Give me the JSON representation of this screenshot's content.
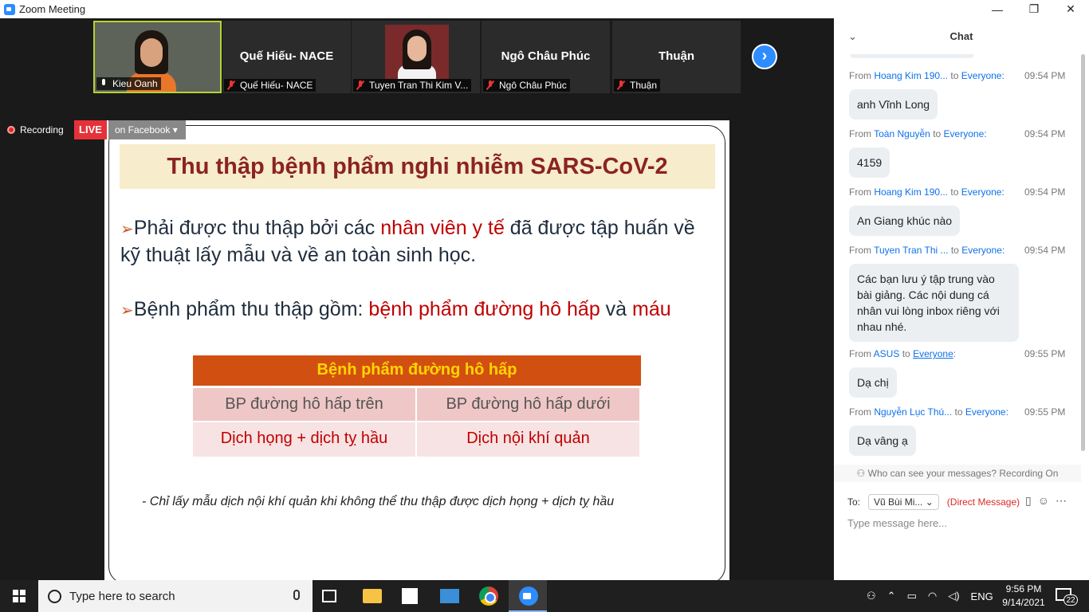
{
  "window": {
    "title": "Zoom Meeting",
    "minimize": "—",
    "restore": "❐",
    "close": "✕"
  },
  "participants": [
    {
      "label": "Kieu Oanh",
      "has_video": true,
      "muted": false
    },
    {
      "name": "Quế Hiếu- NACE",
      "label": "Quế Hiếu- NACE",
      "muted": true
    },
    {
      "label": "Tuyen Tran Thi Kim V...",
      "has_photo": true,
      "muted": true
    },
    {
      "name": "Ngô Châu Phúc",
      "label": "Ngô Châu Phúc",
      "muted": true
    },
    {
      "name": "Thuận",
      "label": "Thuận",
      "muted": true
    }
  ],
  "next_page_icon": "chevron-right-icon",
  "recording": {
    "label": "Recording",
    "live": "LIVE",
    "platform": "on Facebook",
    "caret": "▾"
  },
  "slide": {
    "title": "Thu thập bệnh phẩm nghi nhiễm SARS-CoV-2",
    "bullet1": {
      "arrow": "➢",
      "pre": "Phải được thu thập bởi các ",
      "highlight": "nhân viên y tế",
      "post": " đã được tập huấn về kỹ thuật lấy mẫu và về an toàn sinh học."
    },
    "bullet2": {
      "arrow": "➢",
      "pre": "Bệnh phẩm thu thập gồm: ",
      "highlight1": "bệnh phẩm đường hô hấp",
      "mid": " và ",
      "highlight2": "máu"
    },
    "table": {
      "header": "Bệnh phẩm đường hô hấp",
      "row1": [
        "BP đường hô hấp trên",
        "BP đường hô hấp dưới"
      ],
      "row2": [
        "Dịch họng + dịch tỵ hầu",
        "Dịch nội khí quản"
      ]
    },
    "note": "- Chỉ lấy mẫu dịch nội khí quản khi không thể thu thập được dịch họng + dịch tỵ hầu"
  },
  "chat": {
    "title": "Chat",
    "collapse_icon": "⌄",
    "messages": [
      {
        "from_label": "From",
        "sender": "Hoang Kim 190...",
        "to_label": "to",
        "to": "Everyone:",
        "time": "09:54 PM",
        "text": "anh Vĩnh Long"
      },
      {
        "from_label": "From",
        "sender": "Toàn Nguyễn",
        "to_label": "to",
        "to": "Everyone:",
        "time": "09:54 PM",
        "text": "4159"
      },
      {
        "from_label": "From",
        "sender": "Hoang Kim 190...",
        "to_label": "to",
        "to": "Everyone:",
        "time": "09:54 PM",
        "text": "An Giang khúc nào"
      },
      {
        "from_label": "From",
        "sender": "Tuyen Tran Thi ...",
        "to_label": "to",
        "to": "Everyone:",
        "time": "09:54 PM",
        "text": "Các bạn lưu ý tập trung vào bài giảng. Các nội dung cá nhân vui lòng inbox riêng với nhau nhé."
      },
      {
        "from_label": "From",
        "sender": "ASUS",
        "to_label": "to",
        "to": "Everyone",
        "to_suffix": ":",
        "time": "09:55 PM",
        "text": "Dạ chị"
      },
      {
        "from_label": "From",
        "sender": "Nguyễn Lục Thú...",
        "to_label": "to",
        "to": "Everyone:",
        "time": "09:55 PM",
        "text": "Dạ vâng ạ"
      }
    ],
    "who_can_see": "Who can see your messages? Recording On",
    "to_label": "To:",
    "recipient": "Vũ Bùi Mi...",
    "recipient_caret": "⌄",
    "direct_message": "(Direct Message)",
    "input_placeholder": "Type message here..."
  },
  "taskbar": {
    "search_placeholder": "Type here to search",
    "tray_people": "⚇",
    "tray_chevron": "⌃",
    "tray_battery": "▭",
    "tray_wifi": "◠",
    "tray_volume": "◁)",
    "language": "ENG",
    "time": "9:56 PM",
    "date": "9/14/2021",
    "notifications": "22"
  }
}
